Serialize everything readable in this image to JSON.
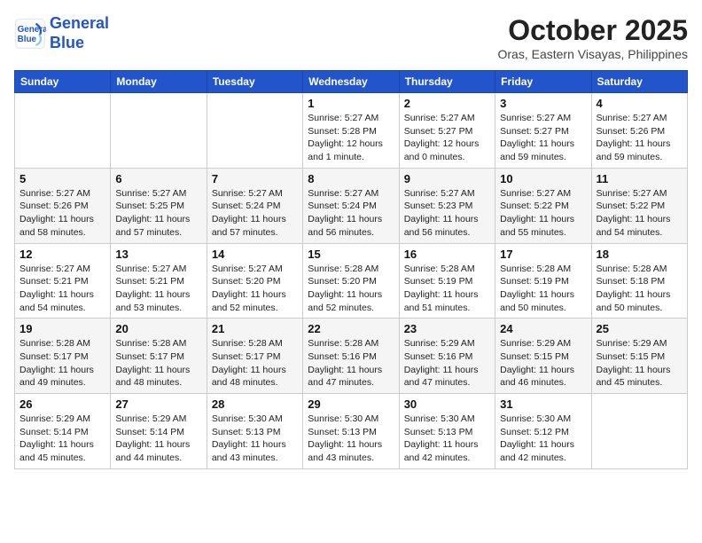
{
  "header": {
    "logo_line1": "General",
    "logo_line2": "Blue",
    "month": "October 2025",
    "location": "Oras, Eastern Visayas, Philippines"
  },
  "weekdays": [
    "Sunday",
    "Monday",
    "Tuesday",
    "Wednesday",
    "Thursday",
    "Friday",
    "Saturday"
  ],
  "weeks": [
    [
      {
        "day": "",
        "info": ""
      },
      {
        "day": "",
        "info": ""
      },
      {
        "day": "",
        "info": ""
      },
      {
        "day": "1",
        "info": "Sunrise: 5:27 AM\nSunset: 5:28 PM\nDaylight: 12 hours\nand 1 minute."
      },
      {
        "day": "2",
        "info": "Sunrise: 5:27 AM\nSunset: 5:27 PM\nDaylight: 12 hours\nand 0 minutes."
      },
      {
        "day": "3",
        "info": "Sunrise: 5:27 AM\nSunset: 5:27 PM\nDaylight: 11 hours\nand 59 minutes."
      },
      {
        "day": "4",
        "info": "Sunrise: 5:27 AM\nSunset: 5:26 PM\nDaylight: 11 hours\nand 59 minutes."
      }
    ],
    [
      {
        "day": "5",
        "info": "Sunrise: 5:27 AM\nSunset: 5:26 PM\nDaylight: 11 hours\nand 58 minutes."
      },
      {
        "day": "6",
        "info": "Sunrise: 5:27 AM\nSunset: 5:25 PM\nDaylight: 11 hours\nand 57 minutes."
      },
      {
        "day": "7",
        "info": "Sunrise: 5:27 AM\nSunset: 5:24 PM\nDaylight: 11 hours\nand 57 minutes."
      },
      {
        "day": "8",
        "info": "Sunrise: 5:27 AM\nSunset: 5:24 PM\nDaylight: 11 hours\nand 56 minutes."
      },
      {
        "day": "9",
        "info": "Sunrise: 5:27 AM\nSunset: 5:23 PM\nDaylight: 11 hours\nand 56 minutes."
      },
      {
        "day": "10",
        "info": "Sunrise: 5:27 AM\nSunset: 5:22 PM\nDaylight: 11 hours\nand 55 minutes."
      },
      {
        "day": "11",
        "info": "Sunrise: 5:27 AM\nSunset: 5:22 PM\nDaylight: 11 hours\nand 54 minutes."
      }
    ],
    [
      {
        "day": "12",
        "info": "Sunrise: 5:27 AM\nSunset: 5:21 PM\nDaylight: 11 hours\nand 54 minutes."
      },
      {
        "day": "13",
        "info": "Sunrise: 5:27 AM\nSunset: 5:21 PM\nDaylight: 11 hours\nand 53 minutes."
      },
      {
        "day": "14",
        "info": "Sunrise: 5:27 AM\nSunset: 5:20 PM\nDaylight: 11 hours\nand 52 minutes."
      },
      {
        "day": "15",
        "info": "Sunrise: 5:28 AM\nSunset: 5:20 PM\nDaylight: 11 hours\nand 52 minutes."
      },
      {
        "day": "16",
        "info": "Sunrise: 5:28 AM\nSunset: 5:19 PM\nDaylight: 11 hours\nand 51 minutes."
      },
      {
        "day": "17",
        "info": "Sunrise: 5:28 AM\nSunset: 5:19 PM\nDaylight: 11 hours\nand 50 minutes."
      },
      {
        "day": "18",
        "info": "Sunrise: 5:28 AM\nSunset: 5:18 PM\nDaylight: 11 hours\nand 50 minutes."
      }
    ],
    [
      {
        "day": "19",
        "info": "Sunrise: 5:28 AM\nSunset: 5:17 PM\nDaylight: 11 hours\nand 49 minutes."
      },
      {
        "day": "20",
        "info": "Sunrise: 5:28 AM\nSunset: 5:17 PM\nDaylight: 11 hours\nand 48 minutes."
      },
      {
        "day": "21",
        "info": "Sunrise: 5:28 AM\nSunset: 5:17 PM\nDaylight: 11 hours\nand 48 minutes."
      },
      {
        "day": "22",
        "info": "Sunrise: 5:28 AM\nSunset: 5:16 PM\nDaylight: 11 hours\nand 47 minutes."
      },
      {
        "day": "23",
        "info": "Sunrise: 5:29 AM\nSunset: 5:16 PM\nDaylight: 11 hours\nand 47 minutes."
      },
      {
        "day": "24",
        "info": "Sunrise: 5:29 AM\nSunset: 5:15 PM\nDaylight: 11 hours\nand 46 minutes."
      },
      {
        "day": "25",
        "info": "Sunrise: 5:29 AM\nSunset: 5:15 PM\nDaylight: 11 hours\nand 45 minutes."
      }
    ],
    [
      {
        "day": "26",
        "info": "Sunrise: 5:29 AM\nSunset: 5:14 PM\nDaylight: 11 hours\nand 45 minutes."
      },
      {
        "day": "27",
        "info": "Sunrise: 5:29 AM\nSunset: 5:14 PM\nDaylight: 11 hours\nand 44 minutes."
      },
      {
        "day": "28",
        "info": "Sunrise: 5:30 AM\nSunset: 5:13 PM\nDaylight: 11 hours\nand 43 minutes."
      },
      {
        "day": "29",
        "info": "Sunrise: 5:30 AM\nSunset: 5:13 PM\nDaylight: 11 hours\nand 43 minutes."
      },
      {
        "day": "30",
        "info": "Sunrise: 5:30 AM\nSunset: 5:13 PM\nDaylight: 11 hours\nand 42 minutes."
      },
      {
        "day": "31",
        "info": "Sunrise: 5:30 AM\nSunset: 5:12 PM\nDaylight: 11 hours\nand 42 minutes."
      },
      {
        "day": "",
        "info": ""
      }
    ]
  ]
}
